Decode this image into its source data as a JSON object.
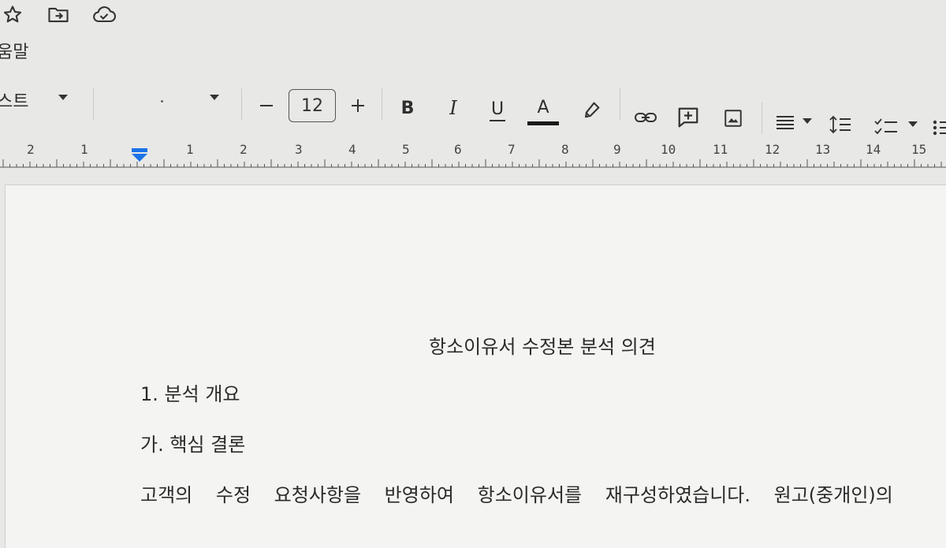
{
  "menu": {
    "help": "움말"
  },
  "toolbar": {
    "style_label": "스트",
    "font_size": "12",
    "bold": "B",
    "italic": "I",
    "underline": "U",
    "text_color": "A",
    "text_color_hex": "#1a1a1a"
  },
  "ruler": {
    "marks": [
      "2",
      "1",
      "1",
      "2",
      "3",
      "4",
      "5",
      "6",
      "7",
      "8",
      "9",
      "10",
      "11",
      "12",
      "13",
      "14",
      "15"
    ]
  },
  "document": {
    "title": "항소이유서 수정본 분석 의견",
    "heading1": "1. 분석 개요",
    "heading2": "가. 핵심 결론",
    "paragraph": "고객의 수정 요청사항을 반영하여 항소이유서를 재구성하였습니다. 원고(중개인)의"
  }
}
